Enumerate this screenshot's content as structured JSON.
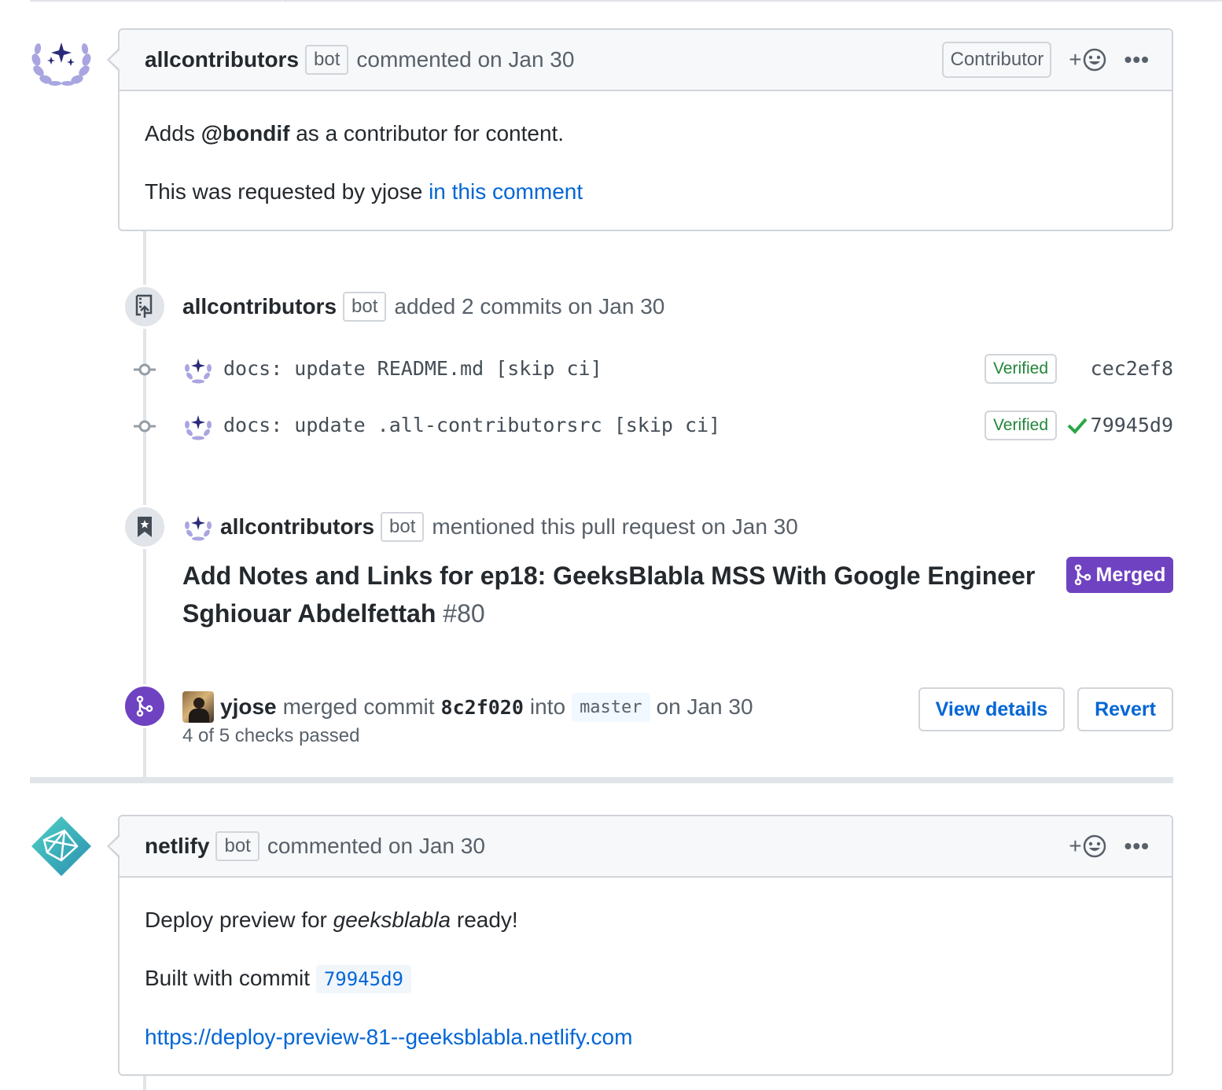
{
  "comment1": {
    "author": "allcontributors",
    "bot_label": "bot",
    "action": "commented on Jan 30",
    "role": "Contributor",
    "react": "+",
    "more": "•••",
    "body_prefix": "Adds ",
    "body_mention": "@bondif",
    "body_suffix": " as a contributor for content.",
    "requested_prefix": "This was requested by yjose ",
    "requested_link": "in this comment"
  },
  "commits_event": {
    "author": "allcontributors",
    "bot_label": "bot",
    "action": "added 2 commits on Jan 30",
    "commits": [
      {
        "message": "docs: update README.md [skip ci]",
        "verified": "Verified",
        "sha": "cec2ef8",
        "check": false
      },
      {
        "message": "docs: update .all-contributorsrc [skip ci]",
        "verified": "Verified",
        "sha": "79945d9",
        "check": true
      }
    ]
  },
  "mention_event": {
    "author": "allcontributors",
    "bot_label": "bot",
    "action": "mentioned this pull request on Jan 30",
    "pr_title": "Add Notes and Links for ep18: GeeksBlabla MSS With Google Engineer Sghiouar Abdelfettah",
    "pr_number": "#80",
    "status": "Merged"
  },
  "merge_event": {
    "author": "yjose",
    "text1": "merged commit",
    "sha": "8c2f020",
    "text2": "into",
    "branch": "master",
    "text3": "on Jan 30",
    "checks": "4 of 5 checks passed",
    "view_details": "View details",
    "revert": "Revert"
  },
  "comment2": {
    "author": "netlify",
    "bot_label": "bot",
    "action": "commented on Jan 30",
    "react": "+",
    "more": "•••",
    "deploy_prefix": "Deploy preview for ",
    "deploy_site": "geeksblabla",
    "deploy_suffix": " ready!",
    "built_prefix": "Built with commit ",
    "built_sha": "79945d9",
    "url": "https://deploy-preview-81--geeksblabla.netlify.com"
  },
  "colors": {
    "link": "#0366d6",
    "merged": "#6f42c1",
    "verified": "#22863a",
    "border": "#d1d5da"
  }
}
